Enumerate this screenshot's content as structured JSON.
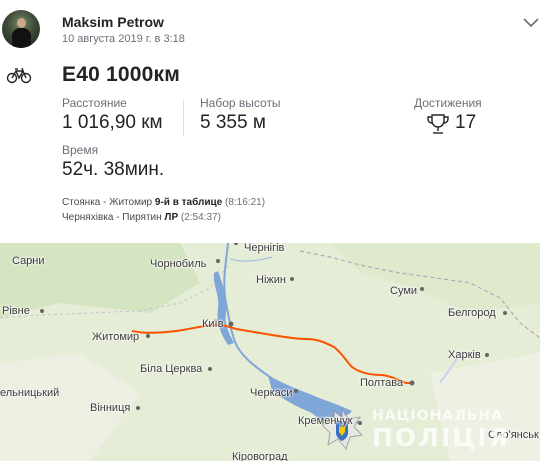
{
  "athlete": {
    "name": "Maksim Petrow",
    "date": "10 августа 2019 г. в 3:18"
  },
  "activity": {
    "type_icon": "bike-icon",
    "title": "E40 1000км"
  },
  "stats": {
    "distance": {
      "label": "Расстояние",
      "value": "1 016,90 км"
    },
    "elevation": {
      "label": "Набор высоты",
      "value": "5 355 м"
    },
    "achievements": {
      "label": "Достижения",
      "value": "17",
      "icon": "trophy-icon"
    },
    "time": {
      "label": "Время",
      "value": "52ч. 38мин."
    }
  },
  "segments": [
    {
      "name": "Стоянка - Житомир",
      "rank": "9-й в таблице",
      "time": "(8:16:21)"
    },
    {
      "name": "Черняхівка - Пирятин",
      "rank": "ЛР",
      "time": "(2:54:37)"
    }
  ],
  "map": {
    "cities": {
      "sarny": "Сарни",
      "chornobyl": "Чорнобиль",
      "chernihiv": "Чернігів",
      "nizhyn": "Ніжин",
      "sumy": "Суми",
      "rivne": "Рівне",
      "zhytomyr": "Житомир",
      "kyiv": "Київ",
      "belgorod": "Белгород",
      "bila_tserkva": "Біла Церква",
      "kharkiv": "Харків",
      "poltava": "Полтава",
      "cherkasy": "Черкаси",
      "khmelnytskyi": "ельницький",
      "vinnytsia": "Вінниця",
      "kremenchuk": "Кременчук",
      "sloviansk": "Сло'янськ",
      "kropyvnytskyi": "Кіровоград"
    },
    "route_color": "#fc5200",
    "water_color": "#7fa6d8"
  },
  "watermark": {
    "line1": "НАЦІОНАЛЬНА",
    "line2": "ПОЛІЦІЯ"
  }
}
